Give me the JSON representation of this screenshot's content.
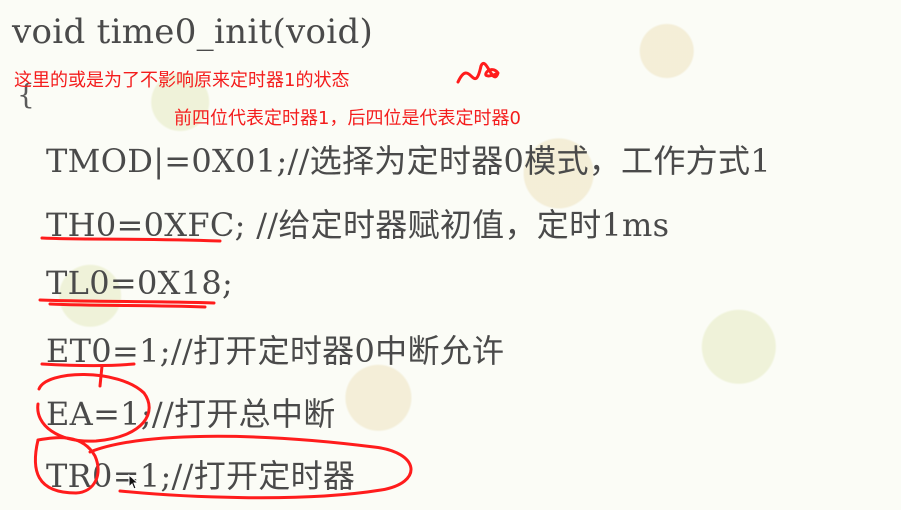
{
  "code": {
    "header": "void time0_init(void)",
    "open_brace": "{",
    "lines": [
      "TMOD|=0X01;//选择为定时器0模式，工作方式1",
      "TH0=0XFC;   //给定时器赋初值，定时1ms",
      "TL0=0X18;",
      "ET0=1;//打开定时器0中断允许",
      "EA=1;//打开总中断",
      "TR0=1;//打开定时器"
    ]
  },
  "annotations": {
    "note_1": "这里的或是为了不影响原来定时器1的状态",
    "note_2": "前四位代表定时器1，后四位是代表定时器0"
  }
}
